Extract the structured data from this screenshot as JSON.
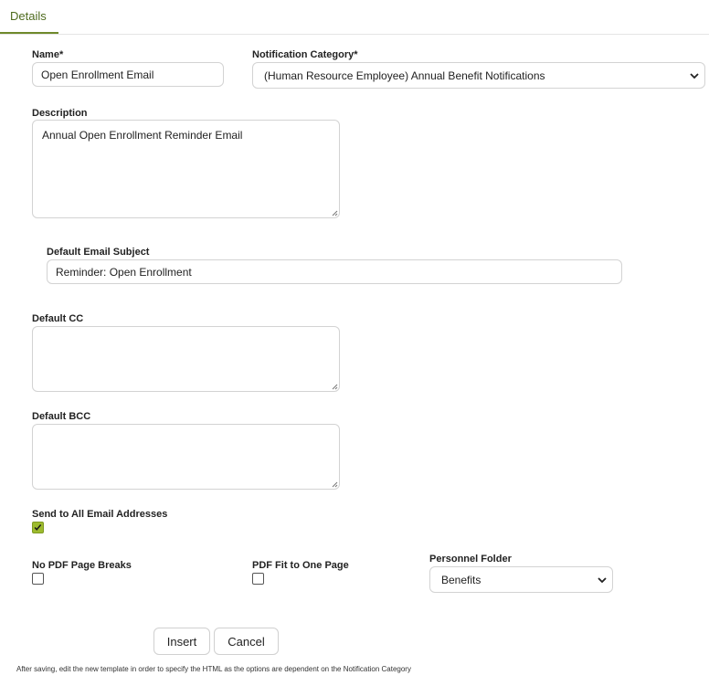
{
  "tabs": [
    {
      "label": "Details",
      "active": true
    }
  ],
  "form": {
    "name": {
      "label": "Name*",
      "value": "Open Enrollment Email"
    },
    "notification_category": {
      "label": "Notification Category*",
      "value": "(Human Resource Employee) Annual Benefit Notifications"
    },
    "description": {
      "label": "Description",
      "value": "Annual Open Enrollment Reminder Email"
    },
    "default_email_subject": {
      "label": "Default Email Subject",
      "value": "Reminder: Open Enrollment"
    },
    "default_cc": {
      "label": "Default CC",
      "value": ""
    },
    "default_bcc": {
      "label": "Default BCC",
      "value": ""
    },
    "send_to_all": {
      "label": "Send to All Email Addresses",
      "checked": true
    },
    "no_pdf_page_breaks": {
      "label": "No PDF Page Breaks",
      "checked": false
    },
    "pdf_fit_one_page": {
      "label": "PDF Fit to One Page",
      "checked": false
    },
    "personnel_folder": {
      "label": "Personnel Folder",
      "value": "Benefits"
    }
  },
  "buttons": {
    "insert": "Insert",
    "cancel": "Cancel"
  },
  "footer_note": "After saving, edit the new template in order to specify the HTML as the options are dependent on the Notification Category",
  "colors": {
    "accent": "#6f8a2b",
    "checkbox_checked": "#9dbb2e"
  }
}
